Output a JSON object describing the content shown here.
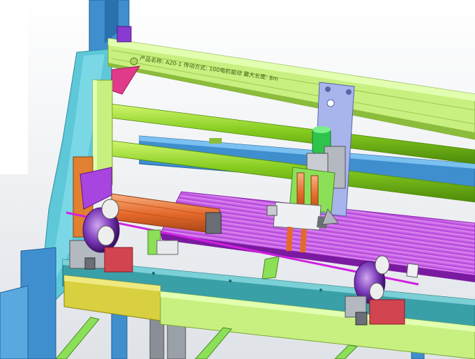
{
  "viewport": {
    "background_top": "#ffffff",
    "background_bottom": "#d9dde3"
  },
  "colors": {
    "frame_blue": "#3f8fcf",
    "frame_blue_dark": "#1f5f99",
    "frame_cyan": "#5ec8d8",
    "rail_green": "#c8f080",
    "rail_green_dark": "#8cbc3c",
    "rod_green": "#7ac21a",
    "rod_green_light": "#b8ea48",
    "tray_magenta": "#c24ee4",
    "tray_magenta_light": "#e08cf4",
    "wire_magenta": "#d020e0",
    "cylinder_orange": "#e46a2c",
    "cylinder_orange_light": "#f4a06a",
    "roller_purple": "#6a28a8",
    "roller_purple_light": "#a868d8",
    "block_red": "#d24450",
    "plate_periwinkle": "#a8b4ec",
    "base_yellow": "#d8d040",
    "base_yellow_dark": "#a8a018",
    "slot_grey": "#8a8e96"
  },
  "rail_engraving": "产品名称: A20-1  传动方式: 100电机驱动  最大长度: 8m",
  "icons": {
    "nozzle": "pneumatic-nozzle-icon",
    "roller": "pinch-roller-icon",
    "cylinder": "air-cylinder-icon"
  }
}
